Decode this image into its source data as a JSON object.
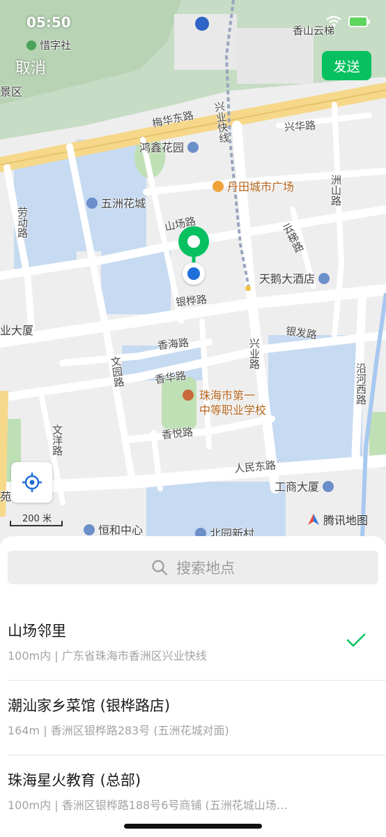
{
  "status_bar": {
    "time": "05:50"
  },
  "header": {
    "cancel_label": "取消",
    "send_label": "发送"
  },
  "map": {
    "roads": {
      "meihua_east": "梅华东路",
      "xingye_express": "兴业快线",
      "xinghua": "兴华路",
      "zhoushan": "洲山路",
      "shanchang": "山场路",
      "laodong": "劳动路",
      "yunji": "云梯路",
      "yinhua": "银桦路",
      "yinfa": "银发路",
      "xianghai": "香海路",
      "xianghua": "香华路",
      "wenyuan": "文园路",
      "xingye": "兴业路",
      "yanhe_west": "沿河西路",
      "wenyang": "文洋路",
      "xiangyue": "香悦路",
      "renmin_east": "人民东路"
    },
    "pois": {
      "xizishe": "惜字社",
      "xiangshan_yunti": "香山云梯",
      "jingqu": "景区",
      "hongxin_garden": "鸿鑫花园",
      "dantian_plaza": "丹田城市广场",
      "wuzhou_garden": "五洲花城",
      "tianhe_hotel": "天鹅大酒店",
      "ye_building": "业大厦",
      "school_line1": "珠海市第一",
      "school_line2": "中等职业学校",
      "gongshang_building": "工商大厦",
      "henghe_center": "恒和中心",
      "beiyuan_village": "北园新村",
      "yuan": "苑"
    },
    "scale_label": "200 米",
    "provider": "腾讯地图"
  },
  "search": {
    "placeholder": "搜索地点"
  },
  "results": [
    {
      "name": "山场邻里",
      "detail": "100m内 | 广东省珠海市香洲区兴业快线",
      "selected": true
    },
    {
      "name": "潮汕家乡菜馆 (银桦路店)",
      "detail": "164m | 香洲区银桦路283号 (五洲花城对面)",
      "selected": false
    },
    {
      "name": "珠海星火教育 (总部)",
      "detail": "100m内 | 香洲区银桦路188号6号商铺 (五洲花城山场…",
      "selected": false
    }
  ],
  "colors": {
    "accent": "#07c160",
    "pin": "#07c160",
    "location_dot": "#1e6fd9"
  }
}
